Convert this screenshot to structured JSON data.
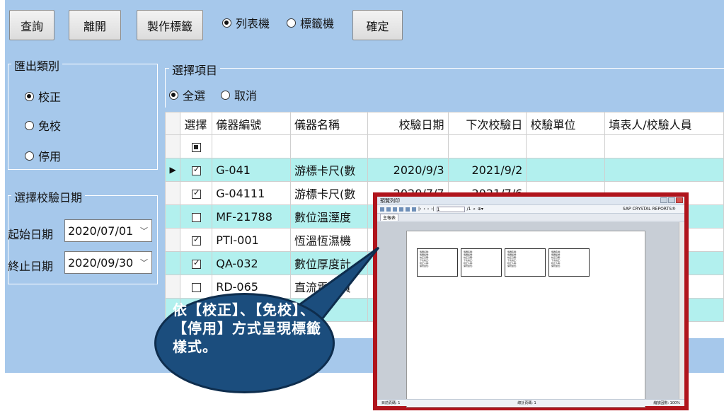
{
  "toolbar": {
    "query_label": "查詢",
    "exit_label": "離開",
    "make_label_label": "製作標籤",
    "printer_options": [
      "列表機",
      "標籤機"
    ],
    "printer_selected": 0,
    "confirm_label": "確定"
  },
  "export_category": {
    "title": "匯出類別",
    "options": [
      "校正",
      "免校",
      "停用"
    ],
    "selected": 0
  },
  "date_group": {
    "title": "選擇校驗日期",
    "start_label": "起始日期",
    "start_value": "2020/07/01",
    "end_label": "終止日期",
    "end_value": "2020/09/30"
  },
  "select_items": {
    "title": "選擇項目",
    "options": [
      "全選",
      "取消"
    ],
    "selected": 0
  },
  "grid": {
    "columns": [
      "選擇",
      "儀器編號",
      "儀器名稱",
      "校驗日期",
      "下次校驗日",
      "校驗單位",
      "填表人/校驗人員"
    ],
    "rows": [
      {
        "checked": true,
        "id": "G-041",
        "name": "游標卡尺(數",
        "cal_date": "2020/9/3",
        "next_date": "2021/9/2",
        "unit": "",
        "person": ""
      },
      {
        "checked": true,
        "id": "G-04111",
        "name": "游標卡尺(數",
        "cal_date": "2020/7/7",
        "next_date": "2021/7/6",
        "unit": "",
        "person": ""
      },
      {
        "checked": false,
        "id": "MF-21788",
        "name": "數位溫溼度",
        "cal_date": "",
        "next_date": "",
        "unit": "",
        "person": ""
      },
      {
        "checked": true,
        "id": "PTI-001",
        "name": "恆溫恆濕機",
        "cal_date": "",
        "next_date": "",
        "unit": "",
        "person": ""
      },
      {
        "checked": true,
        "id": "QA-032",
        "name": "數位厚度計",
        "cal_date": "",
        "next_date": "",
        "unit": "",
        "person": ""
      },
      {
        "checked": false,
        "id": "RD-065",
        "name": "直流電子負",
        "cal_date": "",
        "next_date": "",
        "unit": "",
        "person": ""
      },
      {
        "checked": false,
        "id": "",
        "name": "卡",
        "cal_date": "",
        "next_date": "",
        "unit": "",
        "person": ""
      }
    ]
  },
  "preview": {
    "title": "預覽列印",
    "tab": "主報表",
    "page_box": "1",
    "page_total": "/1",
    "brand": "SAP CRYSTAL REPORTS®",
    "status_left": "目前頁碼: 1",
    "status_mid": "總計頁碼: 1",
    "status_right": "縮放因數: 100%",
    "label_lines": [
      "儀器名稱:",
      "儀器編號:",
      "校正日期:",
      "下次校正:",
      "校正人員:",
      "保管單位:"
    ]
  },
  "callout": {
    "text": "依【校正】、【免校】、【停用】方式呈現標籤樣式。"
  },
  "colors": {
    "app_bg": "#a6c8eb",
    "row_highlight": "#b2f0ee",
    "popup_border": "#b0141c",
    "bubble": "#1b4d7d"
  }
}
